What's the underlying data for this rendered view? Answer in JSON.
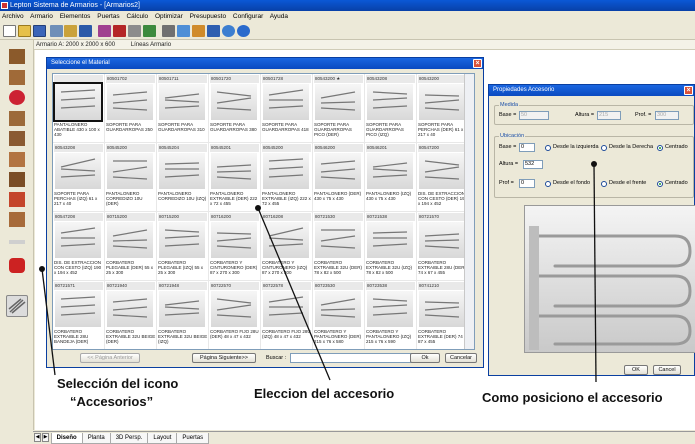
{
  "window": {
    "title": "Lepton Sistema de Armarios - [Armarios2]"
  },
  "menu": [
    "Archivo",
    "Armario",
    "Elementos",
    "Puertas",
    "Cálculo",
    "Optimizar",
    "Presupuesto",
    "Configurar",
    "Ayuda"
  ],
  "breadcrumb": {
    "dims": "Armario A: 2000 x 2000 x 600",
    "lines": "Líneas Armario"
  },
  "dialog": {
    "title": "Seleccione el Material",
    "items": [
      {
        "code": "",
        "label": "PANTALONERO ABATIBLE 430 x 100 x 430"
      },
      {
        "code": "80501702",
        "label": "SOPORTE PARA GUARDARROPAS 250"
      },
      {
        "code": "80501711",
        "label": "SOPORTE PARA GUARDARROPAS 310"
      },
      {
        "code": "80501720",
        "label": "SOPORTE PARA GUARDARROPAS 380"
      },
      {
        "code": "80501728",
        "label": "SOPORTE PARA GUARDARROPAS 418"
      },
      {
        "code": "80543200 ★",
        "label": "SOPORTE PARA GUARDARROPAS PICO (DER)"
      },
      {
        "code": "80543208",
        "label": "SOPORTE PARA GUARDARROPAS PICO (IZQ)"
      },
      {
        "code": "80543200",
        "label": "SOPORTE PARA PERCHAS (DER) 61 x 217 x 40"
      },
      {
        "code": "80543208",
        "label": "SOPORTE PARA PERCHAS (IZQ) 61 x 217 x 40"
      },
      {
        "code": "80545200",
        "label": "PANTALONERO CORREDIZO 10U (DER)"
      },
      {
        "code": "80545204",
        "label": "PANTALONERO CORREDIZO 10U (IZQ)"
      },
      {
        "code": "80545201",
        "label": "PANTALONERO EXTRAIBLE (DER) 222 x 72 x 455"
      },
      {
        "code": "80545200",
        "label": "PANTALONERO EXTRAIBLE (IZQ) 222 x 72 x 455"
      },
      {
        "code": "80546200",
        "label": "PANTALONERO (DER) 430 x 75 x 430"
      },
      {
        "code": "80546201",
        "label": "PANTALONERO (IZQ) 430 x 75 x 430"
      },
      {
        "code": "80547200",
        "label": "DIS. DE EXTRACCION CON CESTO (DER) 190 x 194 x 452"
      },
      {
        "code": "80547208",
        "label": "DIS. DE EXTRACCION CON CESTO (IZQ) 190 x 194 x 452"
      },
      {
        "code": "80715200",
        "label": "CORBATERO PLEGABLE (DER) 55 x 25 x 300"
      },
      {
        "code": "80715200",
        "label": "CORBATERO PLEGABLE (IZQ) 55 x 25 x 300"
      },
      {
        "code": "80716200",
        "label": "CORBATERO Y CINTURONERO (DER) 87 x 270 x 300"
      },
      {
        "code": "80716208",
        "label": "CORBATERO Y CINTURONERO (IZQ) 87 x 270 x 300"
      },
      {
        "code": "80721530",
        "label": "CORBATERO EXTRAIBLE 32U (DER) 78 x 82 x 500"
      },
      {
        "code": "80721538",
        "label": "CORBATERO EXTRAIBLE 32U (IZQ) 78 x 82 x 500"
      },
      {
        "code": "80721570",
        "label": "CORBATERO EXTRAIBLE 28U (DER) 74 x 67 x 455"
      },
      {
        "code": "80721571",
        "label": "CORBATERO EXTRAIBLE 28U BANDEJA (DER)"
      },
      {
        "code": "80721940",
        "label": "CORBATERO EXTRAIBLE 32U BEIGE (DER)"
      },
      {
        "code": "80721948",
        "label": "CORBATERO EXTRAIBLE 32U BEIGE (IZQ)"
      },
      {
        "code": "80722570",
        "label": "CORBATERO FIJO 28U (DER) 48 x 47 x 432"
      },
      {
        "code": "80722578",
        "label": "CORBATERO FIJO 28U (IZQ) 48 x 47 x 432"
      },
      {
        "code": "80723530",
        "label": "CORBATERO Y PANTALONERO (DER) 215 x 76 x 580"
      },
      {
        "code": "80723538",
        "label": "CORBATERO Y PANTALONERO (IZQ) 215 x 76 x 590"
      },
      {
        "code": "80741210",
        "label": "CORBATERO EXTRAIBLE (DER) 74 x 87 x 455"
      }
    ],
    "prev_page": "<< Página Anterior",
    "next_page": "Página Siguiente>>",
    "search_label": "Buscar :",
    "search_value": "",
    "ok": "Ok",
    "cancel": "Cancelar"
  },
  "props": {
    "title": "Propiedades Accesorio",
    "medida": {
      "title": "Medida",
      "base_label": "Base =",
      "base_value": "50",
      "alto_label": "Altura =",
      "alto_value": "215",
      "prof_label": "Prof. =",
      "prof_value": "300"
    },
    "ubicacion": {
      "title": "Ubicación",
      "base_label": "Base =",
      "base_value": "0",
      "r1": "Desde la izquierda",
      "r2": "Desde la Derecha",
      "r3": "Centrado",
      "altura_label": "Altura =",
      "altura_value": "532",
      "prof_label": "Prof =",
      "prof_value": "0",
      "r4": "Desde el fondo",
      "r5": "Desde el frente",
      "r6": "Centrado"
    },
    "ok": "OK",
    "cancel": "Cancel"
  },
  "tabs": [
    "Diseño",
    "Planta",
    "3D Persp.",
    "Layout",
    "Puertas"
  ],
  "annotations": {
    "icon_line1": "Selección del icono",
    "icon_line2": "“Accesorios”",
    "choice": "Eleccion del accesorio",
    "position": "Como posiciono el accesorio"
  }
}
